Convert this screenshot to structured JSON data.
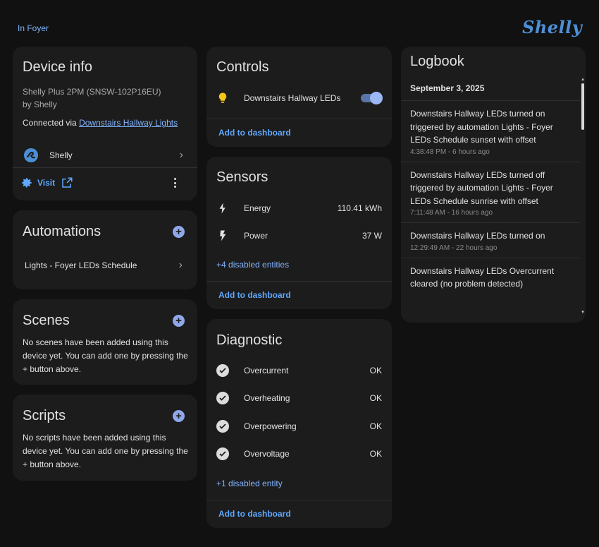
{
  "header": {
    "area_link": "In Foyer",
    "brand": "Shelly"
  },
  "device_info": {
    "title": "Device info",
    "model": "Shelly Plus 2PM (SNSW-102P16EU)",
    "manufacturer": "by Shelly",
    "connected_prefix": "Connected via ",
    "connected_link": "Downstairs Hallway Lights",
    "integration": "Shelly",
    "visit_label": "Visit"
  },
  "automations": {
    "title": "Automations",
    "items": [
      {
        "label": "Lights - Foyer LEDs Schedule"
      }
    ]
  },
  "scenes": {
    "title": "Scenes",
    "empty_text": "No scenes have been added using this device yet. You can add one by pressing the + button above."
  },
  "scripts": {
    "title": "Scripts",
    "empty_text": "No scripts have been added using this device yet. You can add one by pressing the + button above."
  },
  "controls": {
    "title": "Controls",
    "items": [
      {
        "label": "Downstairs Hallway LEDs",
        "icon": "lightbulb-icon",
        "on": true
      }
    ],
    "add_to_dashboard": "Add to dashboard"
  },
  "sensors": {
    "title": "Sensors",
    "items": [
      {
        "label": "Energy",
        "value": "110.41 kWh",
        "icon": "lightning-bolt-icon"
      },
      {
        "label": "Power",
        "value": "37 W",
        "icon": "flash-icon"
      }
    ],
    "disabled_link": "+4 disabled entities",
    "add_to_dashboard": "Add to dashboard"
  },
  "diagnostic": {
    "title": "Diagnostic",
    "items": [
      {
        "label": "Overcurrent",
        "value": "OK"
      },
      {
        "label": "Overheating",
        "value": "OK"
      },
      {
        "label": "Overpowering",
        "value": "OK"
      },
      {
        "label": "Overvoltage",
        "value": "OK"
      }
    ],
    "disabled_link": "+1 disabled entity",
    "add_to_dashboard": "Add to dashboard"
  },
  "logbook": {
    "title": "Logbook",
    "date": "September 3, 2025",
    "entries": [
      {
        "text": "Downstairs Hallway LEDs turned on triggered by automation Lights - Foyer LEDs Schedule sunset with offset",
        "time": "4:38:48 PM - 6 hours ago"
      },
      {
        "text": "Downstairs Hallway LEDs turned off triggered by automation Lights - Foyer LEDs Schedule sunrise with offset",
        "time": "7:11:48 AM - 16 hours ago"
      },
      {
        "text": "Downstairs Hallway LEDs turned on",
        "time": "12:29:49 AM - 22 hours ago"
      },
      {
        "text": "Downstairs Hallway LEDs Overcurrent cleared (no problem detected)",
        "time": ""
      }
    ]
  },
  "colors": {
    "accent": "#5fa8ff",
    "card": "#1c1c1c",
    "background": "#111111",
    "toggle_on": "#9bb8f5",
    "bulb": "#f5c518"
  }
}
